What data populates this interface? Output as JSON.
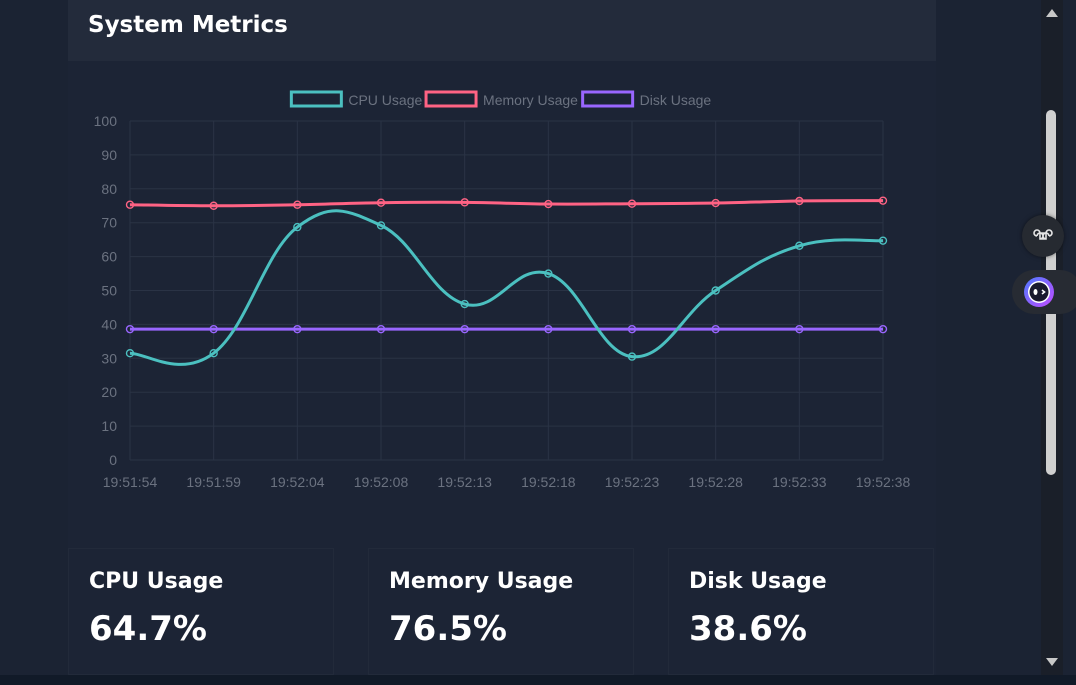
{
  "panel": {
    "title": "System Metrics"
  },
  "chart_data": {
    "type": "line",
    "title": "",
    "xlabel": "",
    "ylabel": "",
    "ylim": [
      0,
      100
    ],
    "yticks": [
      0,
      10,
      20,
      30,
      40,
      50,
      60,
      70,
      80,
      90,
      100
    ],
    "grid": true,
    "legend": "top-center",
    "categories": [
      "19:51:54",
      "19:51:59",
      "19:52:04",
      "19:52:08",
      "19:52:13",
      "19:52:18",
      "19:52:23",
      "19:52:28",
      "19:52:33",
      "19:52:38"
    ],
    "series": [
      {
        "name": "CPU Usage",
        "color": "#4bc0c0",
        "values": [
          31.5,
          31.5,
          68.7,
          69.2,
          46.0,
          55.0,
          30.5,
          50.0,
          63.2,
          64.7
        ]
      },
      {
        "name": "Memory Usage",
        "color": "#ff6384",
        "values": [
          75.3,
          75.0,
          75.3,
          75.9,
          76.0,
          75.5,
          75.6,
          75.8,
          76.4,
          76.5
        ]
      },
      {
        "name": "Disk Usage",
        "color": "#9966ff",
        "values": [
          38.6,
          38.6,
          38.6,
          38.6,
          38.6,
          38.6,
          38.6,
          38.6,
          38.6,
          38.6
        ]
      }
    ]
  },
  "cards": [
    {
      "label": "CPU Usage",
      "value": "64.7%"
    },
    {
      "label": "Memory Usage",
      "value": "76.5%"
    },
    {
      "label": "Disk Usage",
      "value": "38.6%"
    }
  ],
  "colors": {
    "background": "#1b2333",
    "panel": "#1c2435",
    "header": "#232b3b",
    "grid": "#2a3345",
    "tick_text": "#6b7280"
  },
  "icons": {
    "shortcut": "command-icon",
    "assistant": "assistant-face-icon",
    "scroll_up": "scroll-up-arrow-icon",
    "scroll_down": "scroll-down-arrow-icon"
  }
}
